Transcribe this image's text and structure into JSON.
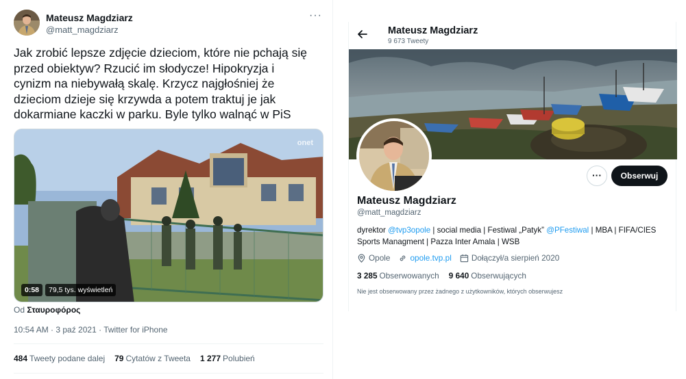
{
  "tweet": {
    "author_name": "Mateusz Magdziarz",
    "author_handle": "@matt_magdziarz",
    "more_icon": "more-horizontal-icon",
    "text_lines": [
      "Jak zrobić lepsze zdjęcie dzieciom, które nie pchają się",
      "przed obiektyw? Rzucić im słodycze! Hipokryzja i",
      "cynizm na niebywałą skalę. Krzycz najgłośniej że",
      "dzieciom dzieje się krzywda a potem traktuj je jak",
      "dokarmiane kaczki w parku. Byle tylko walnąć w PiS"
    ],
    "video": {
      "duration": "0:58",
      "views": "79,5 tys. wyświetleń",
      "watermark": "onet"
    },
    "attribution_prefix": "Od",
    "attribution_source": "Σταυροφόρος",
    "meta": "10:54 AM · 3 paź 2021 · Twitter for iPhone",
    "stats": [
      {
        "num": "484",
        "label": "Tweety podane dalej"
      },
      {
        "num": "79",
        "label": "Cytatów z Tweeta"
      },
      {
        "num": "1 277",
        "label": "Polubień"
      }
    ]
  },
  "profile": {
    "back_icon": "arrow-left-icon",
    "top_name": "Mateusz Magdziarz",
    "top_count": "9 673 Tweety",
    "more_label": "···",
    "follow_label": "Obserwuj",
    "name": "Mateusz Magdziarz",
    "handle": "@matt_magdziarz",
    "bio": {
      "p1": "dyrektor ",
      "l1": "@tvp3opole",
      "p2": " | social media | Festiwal „Patyk” ",
      "l2": "@PFestiwal",
      "p3": " | MBA | FIFA/CIES",
      "line2": "Sports Managment | Pazza Inter Amala | WSB"
    },
    "location": "Opole",
    "website": "opole.tvp.pl",
    "joined": "Dołączył/a sierpień 2020",
    "following_num": "3 285",
    "following_label": "Obserwowanych",
    "followers_num": "9 640",
    "followers_label": "Obserwujących",
    "note": "Nie jest obserwowany przez żadnego z użytkowników, których obserwujesz",
    "colors": {
      "link": "#1d9bf0",
      "follow_button": "#0f1419"
    }
  }
}
